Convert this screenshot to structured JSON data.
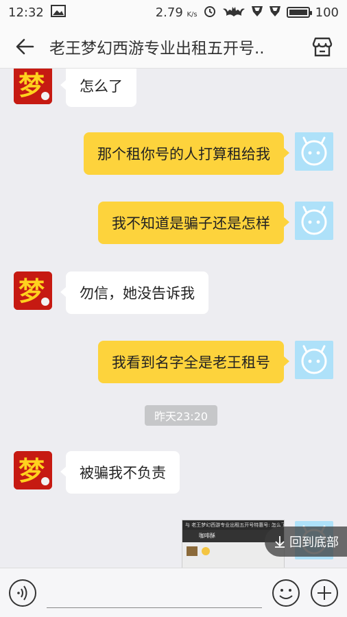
{
  "status_bar": {
    "time": "12:32",
    "net_speed": "2.79",
    "net_unit": "K/s",
    "battery": "100",
    "battery_level": 1.0
  },
  "header": {
    "title": "老王梦幻西游专业出租五开号..",
    "back_icon": "arrow-left-icon",
    "store_icon": "store-icon"
  },
  "messages": [
    {
      "side": "left",
      "text": "怎么了"
    },
    {
      "side": "right",
      "text": "那个租你号的人打算租给我"
    },
    {
      "side": "right",
      "text": "我不知道是骗子还是怎样"
    },
    {
      "side": "left",
      "text": "勿信，她没告诉我"
    },
    {
      "side": "right",
      "text": "我看到名字全是老王租号"
    },
    {
      "side": "left",
      "text": "被骗我不负责"
    }
  ],
  "timestamp": "昨天23:20",
  "image_message": {
    "header_text": "与 老王梦幻西游专业出租五开号特惠号: 怎么了",
    "nav_text": "咖啡酥"
  },
  "scroll_to_bottom": "回到底部",
  "input": {
    "value": "",
    "placeholder": ""
  },
  "colors": {
    "my_bubble": "#fdd33c",
    "their_bubble": "#ffffff",
    "background": "#ededf1",
    "my_avatar": "#aee1f9",
    "game_avatar": "#c61a12"
  }
}
